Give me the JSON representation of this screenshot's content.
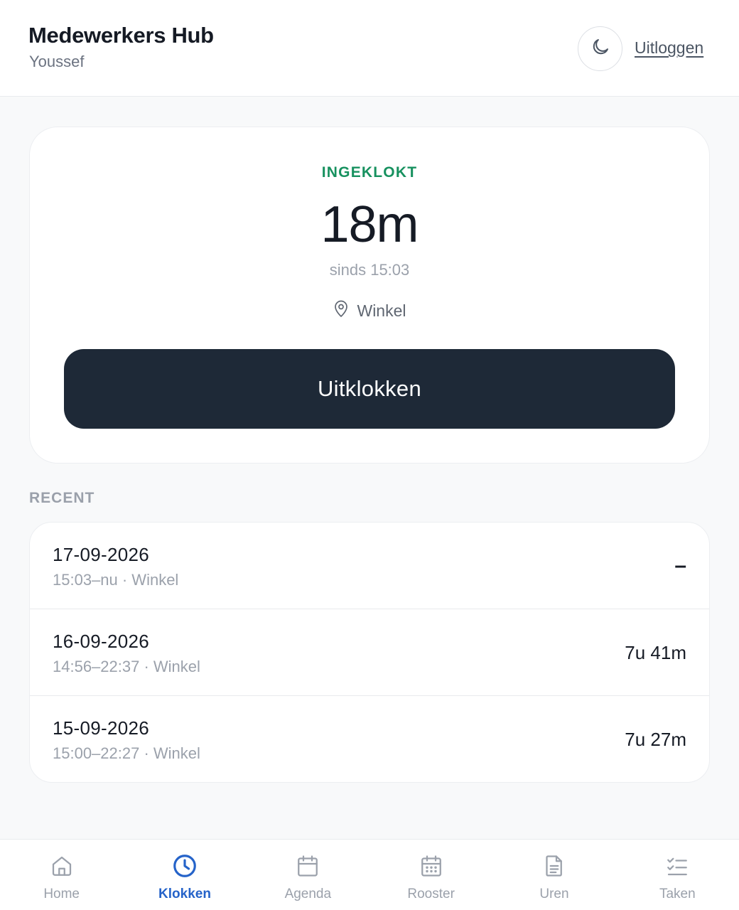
{
  "header": {
    "title": "Medewerkers Hub",
    "user": "Youssef",
    "theme_icon": "moon-icon",
    "logout_label": "Uitloggen"
  },
  "clock": {
    "status": "INGEKLOKT",
    "elapsed": "18m",
    "since": "sinds 15:03",
    "location": "Winkel",
    "location_icon": "map-pin-icon",
    "button_label": "Uitklokken",
    "status_color": "#17915f",
    "button_color": "#1e2937"
  },
  "recent": {
    "heading": "RECENT",
    "entries": [
      {
        "date": "17-09-2026",
        "meta": "15:03–nu · Winkel",
        "duration": "–"
      },
      {
        "date": "16-09-2026",
        "meta": "14:56–22:37 · Winkel",
        "duration": "7u 41m"
      },
      {
        "date": "15-09-2026",
        "meta": "15:00–22:27 · Winkel",
        "duration": "7u 27m"
      }
    ]
  },
  "nav": {
    "active_color": "#2563c9",
    "items": [
      {
        "label": "Home",
        "icon": "home-icon"
      },
      {
        "label": "Klokken",
        "icon": "clock-icon",
        "active": true
      },
      {
        "label": "Agenda",
        "icon": "calendar-icon"
      },
      {
        "label": "Rooster",
        "icon": "schedule-grid-icon"
      },
      {
        "label": "Uren",
        "icon": "document-icon"
      },
      {
        "label": "Taken",
        "icon": "checklist-icon"
      }
    ]
  }
}
